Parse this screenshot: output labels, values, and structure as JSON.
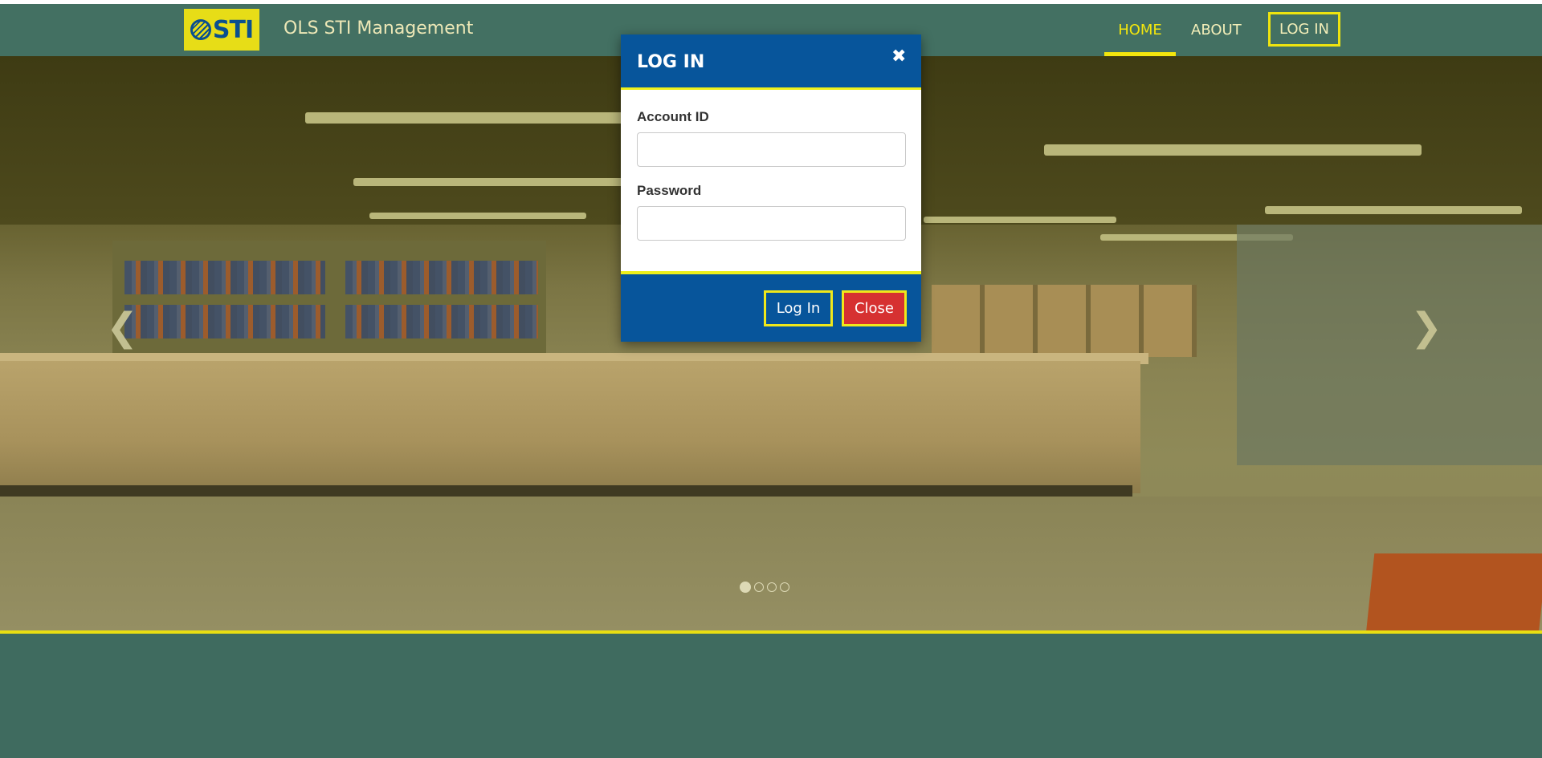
{
  "navbar": {
    "logo_text": "STI",
    "brand": "OLS STI Management",
    "items": [
      {
        "label": "HOME"
      },
      {
        "label": "ABOUT"
      },
      {
        "label": "LOG IN"
      }
    ]
  },
  "carousel": {
    "prev_icon": "chevron-left-icon",
    "next_icon": "chevron-right-icon",
    "slides_count": 4,
    "active_slide": 1
  },
  "modal": {
    "title": "LOG IN",
    "close_icon": "close-icon",
    "fields": [
      {
        "label": "Account ID",
        "value": "",
        "placeholder": ""
      },
      {
        "label": "Password",
        "value": "",
        "placeholder": ""
      }
    ],
    "buttons": {
      "login": "Log In",
      "close": "Close"
    }
  },
  "colors": {
    "navbar": "#437062",
    "accent_yellow": "#e9df12",
    "modal_blue": "#07559b",
    "close_red": "#d63131"
  }
}
